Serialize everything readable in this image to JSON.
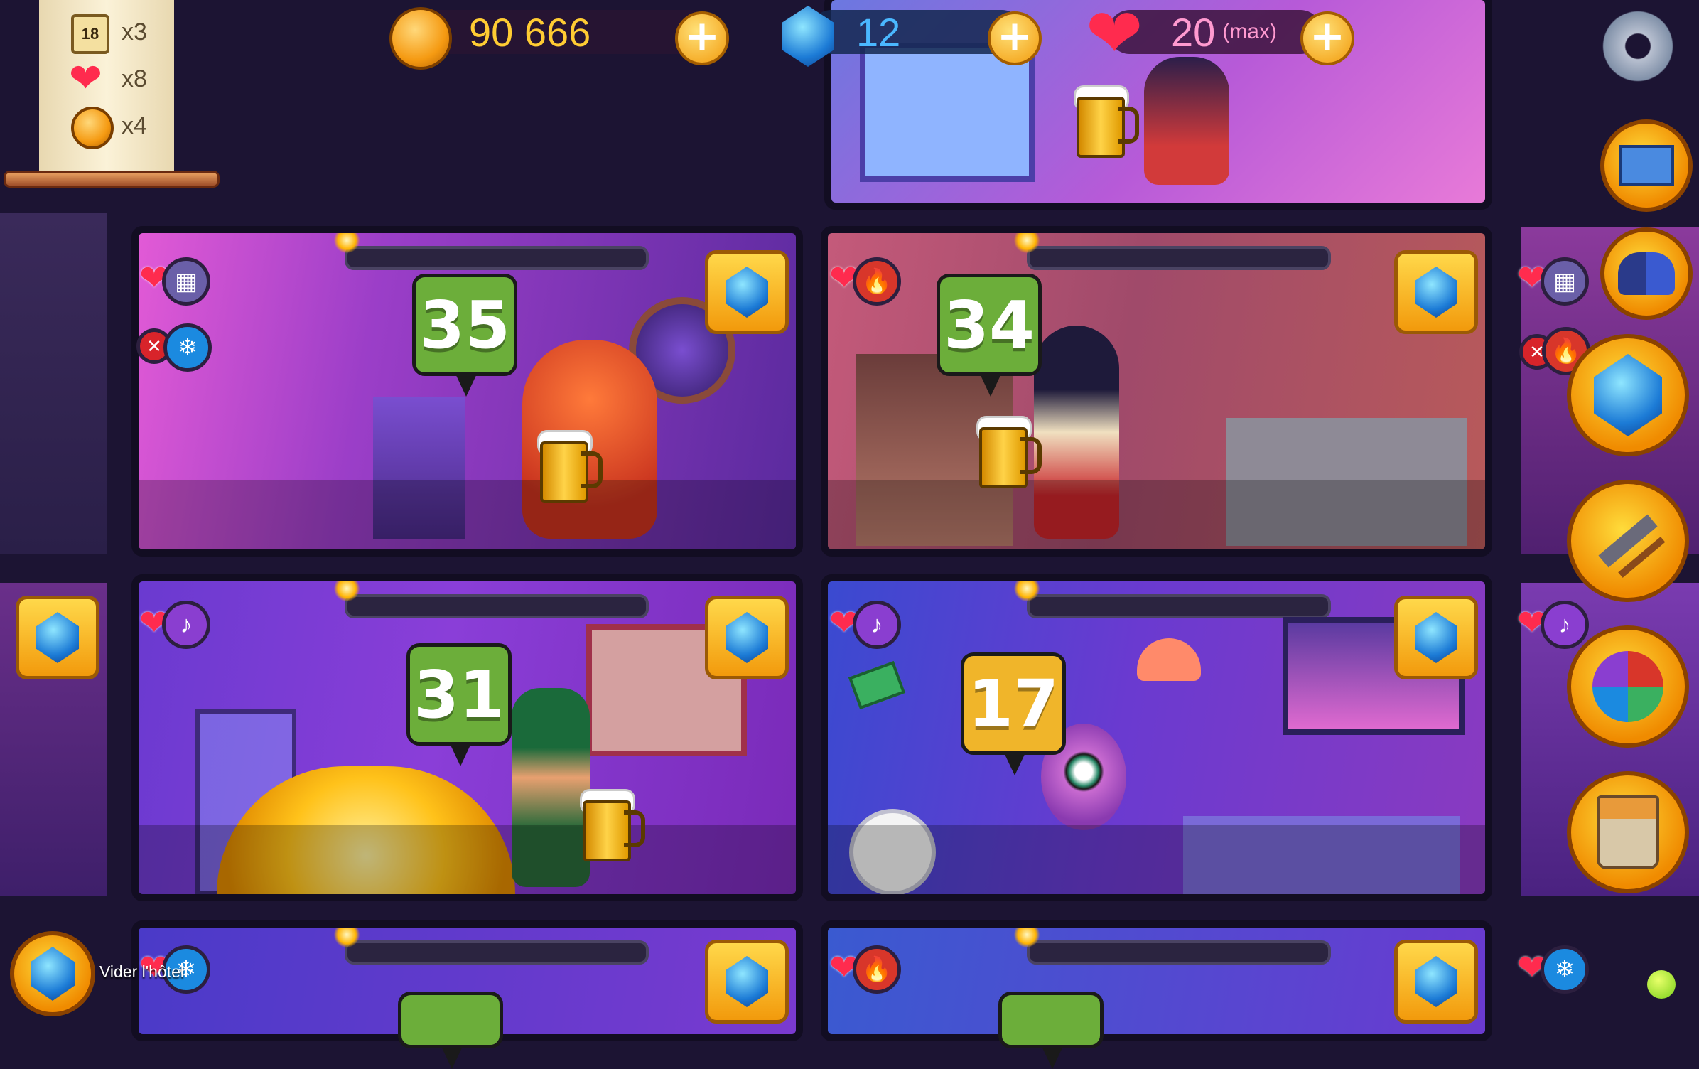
{
  "resources": {
    "coins": "90 666",
    "gems": "12",
    "hearts": "20",
    "hearts_suffix": "(max)",
    "plus": "+"
  },
  "quest_scroll": {
    "items": [
      {
        "icon": "guest-ticket-icon",
        "badge": "18",
        "count": "x3"
      },
      {
        "icon": "heart-icon",
        "count": "x8"
      },
      {
        "icon": "coin-icon",
        "count": "x4"
      }
    ]
  },
  "rooms": [
    {
      "id": "room-r1-left",
      "guest": "red-crab-monster",
      "level": "35",
      "bubble_color": "green"
    },
    {
      "id": "room-r1-right",
      "guest": "elf-girl",
      "level": "34",
      "bubble_color": "green"
    },
    {
      "id": "room-r2-left",
      "guest": "leprechaun",
      "level": "31",
      "bubble_color": "green"
    },
    {
      "id": "room-r2-right",
      "guest": "purple-eye-monster",
      "level": "17",
      "bubble_color": "yellow"
    }
  ],
  "bottom": {
    "empty_hotel_label": "Vider l'hôtel"
  },
  "side_menu": [
    "settings-gear",
    "mail",
    "couple-cats",
    "gem-shop",
    "build-hammer",
    "elements",
    "paint-bucket"
  ],
  "colors": {
    "accent_orange": "#f29a0c",
    "gem_blue": "#1c7bd6",
    "level_green": "#6cae3a",
    "level_yellow": "#f0b52a"
  }
}
